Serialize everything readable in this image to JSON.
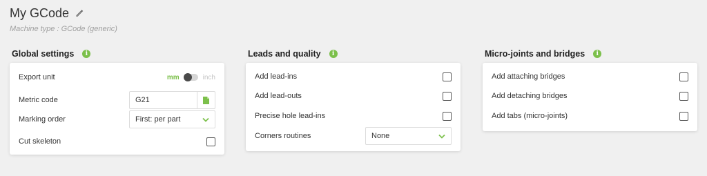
{
  "header": {
    "title": "My GCode",
    "machine_type": "Machine type : GCode (generic)"
  },
  "global_settings": {
    "title": "Global settings",
    "info_glyph": "i",
    "export_unit": {
      "label": "Export unit",
      "option_on": "mm",
      "option_off": "inch",
      "selected": "mm"
    },
    "metric_code": {
      "label": "Metric code",
      "value": "G21"
    },
    "marking_order": {
      "label": "Marking order",
      "value": "First: per part"
    },
    "cut_skeleton": {
      "label": "Cut skeleton",
      "checked": false
    }
  },
  "leads_quality": {
    "title": "Leads and quality",
    "info_glyph": "i",
    "items": [
      {
        "label": "Add lead-ins",
        "checked": false
      },
      {
        "label": "Add lead-outs",
        "checked": false
      },
      {
        "label": "Precise hole lead-ins",
        "checked": false
      }
    ],
    "corners_routines": {
      "label": "Corners routines",
      "value": "None"
    }
  },
  "micro_joints": {
    "title": "Micro-joints and bridges",
    "info_glyph": "i",
    "items": [
      {
        "label": "Add attaching bridges",
        "checked": false
      },
      {
        "label": "Add detaching bridges",
        "checked": false
      },
      {
        "label": "Add tabs (micro-joints)",
        "checked": false
      }
    ]
  },
  "colors": {
    "accent": "#7cc04b",
    "background": "#f0f0f0",
    "card": "#ffffff"
  },
  "icons": [
    "pencil-icon",
    "info-icon",
    "file-icon",
    "chevron-down-icon",
    "checkbox-icon"
  ]
}
